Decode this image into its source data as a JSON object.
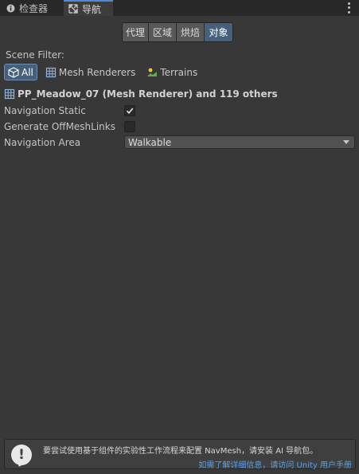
{
  "tabs": [
    {
      "label": "检查器",
      "icon": "info-icon",
      "active": false
    },
    {
      "label": "导航",
      "icon": "navigation-icon",
      "active": true
    }
  ],
  "segments": [
    {
      "label": "代理",
      "selected": false
    },
    {
      "label": "区域",
      "selected": false
    },
    {
      "label": "烘焙",
      "selected": false
    },
    {
      "label": "对象",
      "selected": true
    }
  ],
  "scene_filter": {
    "label": "Scene Filter:",
    "options": [
      {
        "label": "All",
        "icon": "cube-icon",
        "selected": true
      },
      {
        "label": "Mesh Renderers",
        "icon": "mesh-renderer-icon",
        "selected": false
      },
      {
        "label": "Terrains",
        "icon": "terrain-icon",
        "selected": false
      }
    ]
  },
  "object": {
    "title": "PP_Meadow_07 (Mesh Renderer) and 119 others",
    "icon": "mesh-renderer-icon"
  },
  "properties": {
    "navigation_static": {
      "label": "Navigation Static",
      "checked": true
    },
    "generate_offmeshlinks": {
      "label": "Generate OffMeshLinks",
      "checked": false
    },
    "navigation_area": {
      "label": "Navigation Area",
      "value": "Walkable"
    }
  },
  "help": {
    "message": "要尝试使用基于组件的实验性工作流程来配置 NavMesh，请安装 AI 导航包。",
    "link": "如需了解详细信息，请访问 Unity 用户手册"
  },
  "colors": {
    "background": "#383838",
    "accent": "#46607c",
    "link": "#5aa0e8"
  }
}
